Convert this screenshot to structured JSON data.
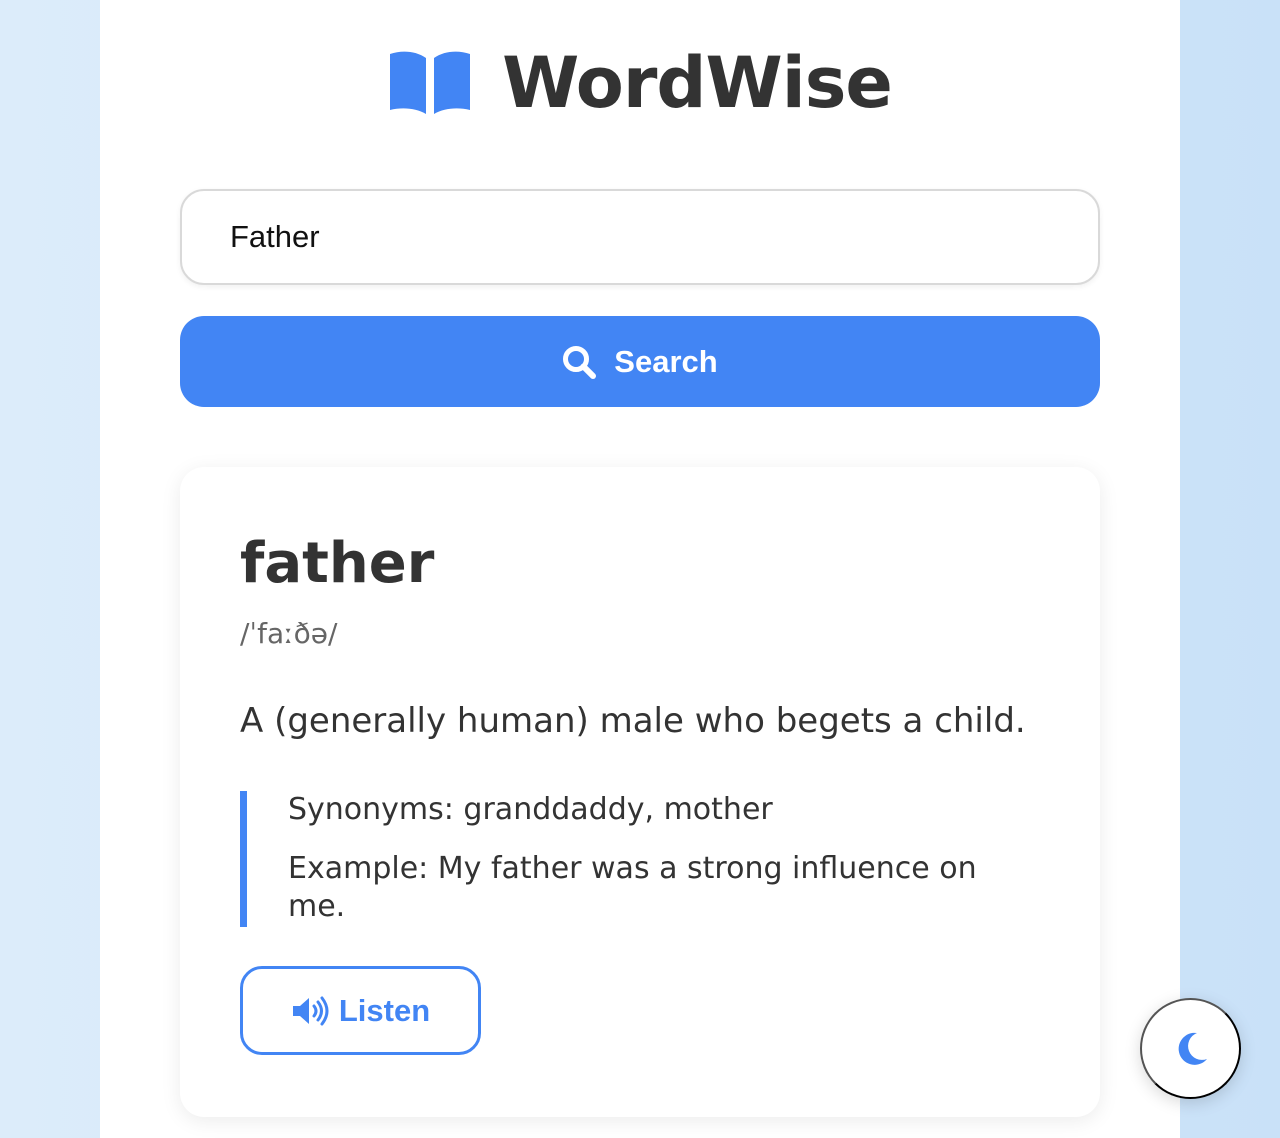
{
  "app": {
    "title": "WordWise",
    "brand_icon": "open-book-icon",
    "accent_color": "#4285f4"
  },
  "search": {
    "value": "Father",
    "button_label": "Search",
    "button_icon": "search-icon"
  },
  "result": {
    "word": "father",
    "phonetic": "/ˈfaːðə/",
    "definition": "A (generally human) male who begets a child.",
    "synonyms": "Synonyms: granddaddy, mother",
    "example": "Example: My father was a strong influence on me.",
    "listen_label": "Listen",
    "listen_icon": "speaker-icon"
  },
  "theme_toggle": {
    "icon": "moon-icon"
  }
}
